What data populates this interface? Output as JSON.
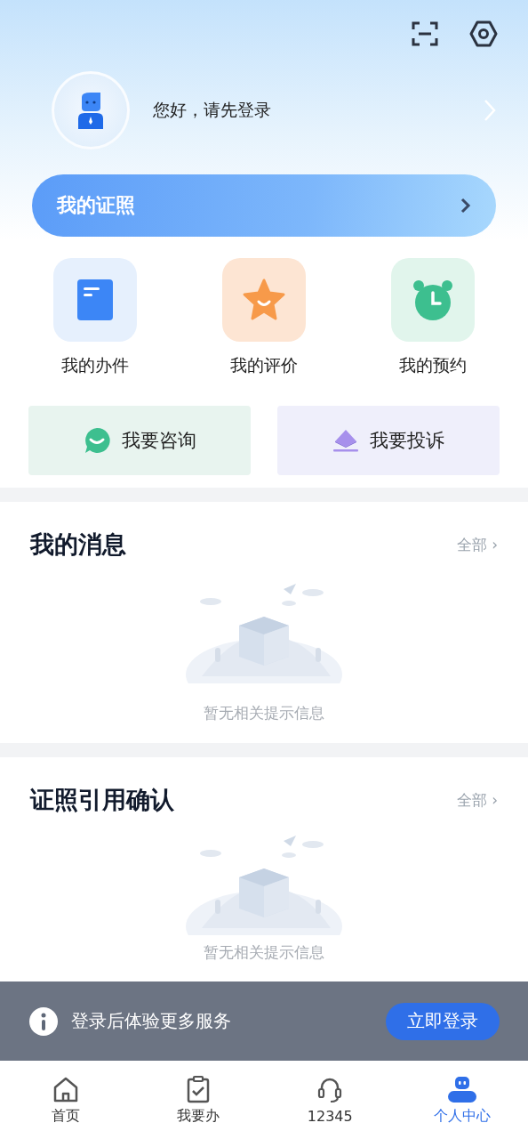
{
  "header": {
    "greeting": "您好，请先登录",
    "license_bar": {
      "label": "我的证照"
    }
  },
  "shortcuts": [
    {
      "label": "我的办件",
      "kind": "document"
    },
    {
      "label": "我的评价",
      "kind": "star"
    },
    {
      "label": "我的预约",
      "kind": "clock"
    }
  ],
  "action_buttons": [
    {
      "label": "我要咨询",
      "kind": "consult"
    },
    {
      "label": "我要投诉",
      "kind": "complaint"
    }
  ],
  "sections": [
    {
      "title": "我的消息",
      "more": "全部 ›",
      "empty_text": "暂无相关提示信息"
    },
    {
      "title": "证照引用确认",
      "more": "全部 ›",
      "empty_text": "暂无相关提示信息"
    }
  ],
  "login_banner": {
    "message": "登录后体验更多服务",
    "button": "立即登录"
  },
  "tab_bar": [
    {
      "label": "首页",
      "kind": "home",
      "selected": false
    },
    {
      "label": "我要办",
      "kind": "todo",
      "selected": false
    },
    {
      "label": "12345",
      "kind": "hotline",
      "selected": false
    },
    {
      "label": "个人中心",
      "kind": "profile",
      "selected": true
    }
  ]
}
